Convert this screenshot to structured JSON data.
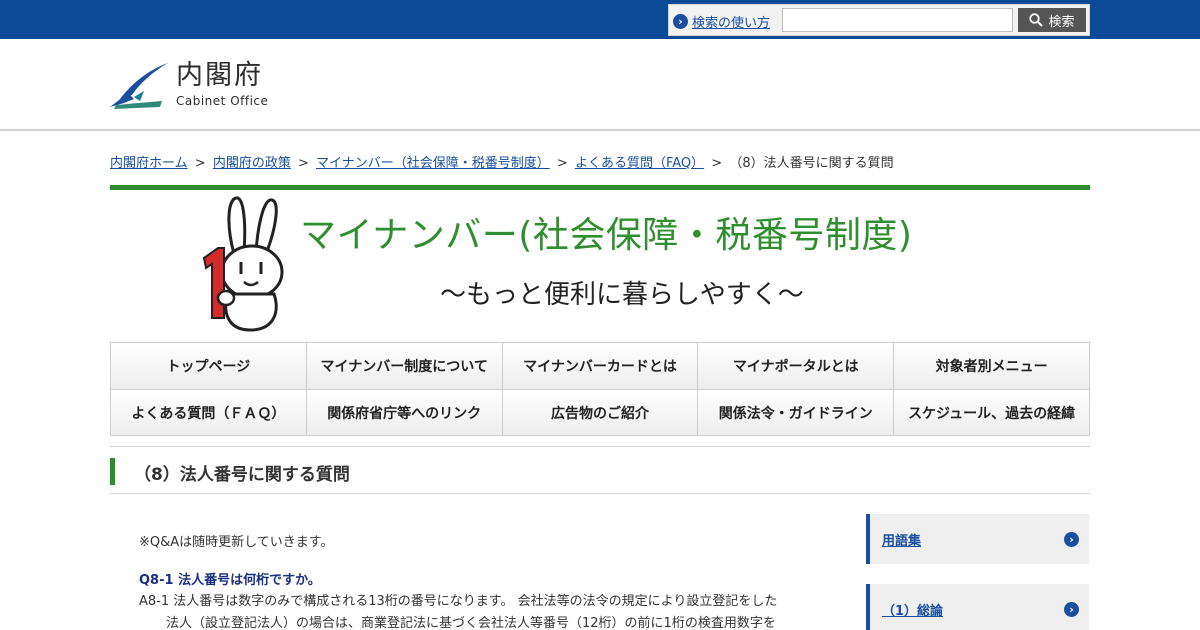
{
  "topbar": {
    "search_help_label": "検索の使い方",
    "search_placeholder": "",
    "search_button_label": "検索",
    "background_color": "#0a4a96"
  },
  "header": {
    "logo_ja": "内閣府",
    "logo_en": "Cabinet Office"
  },
  "breadcrumb": {
    "items": [
      "内閣府ホーム",
      "内閣府の政策",
      "マイナンバー（社会保障・税番号制度）",
      "よくある質問（FAQ）"
    ],
    "current": "（8）法人番号に関する質問",
    "separator": ">"
  },
  "banner": {
    "title": "マイナンバー(社会保障・税番号制度)",
    "subtitle": "〜もっと便利に暮らしやすく〜",
    "accent_color": "#2e8b2e"
  },
  "nav": {
    "row1": [
      "トップページ",
      "マイナンバー制度について",
      "マイナンバーカードとは",
      "マイナポータルとは",
      "対象者別メニュー"
    ],
    "row2": [
      "よくある質問（ＦＡＱ）",
      "関係府省庁等へのリンク",
      "広告物のご紹介",
      "関係法令・ガイドライン",
      "スケジュール、過去の経緯"
    ]
  },
  "section": {
    "heading": "（8）法人番号に関する質問"
  },
  "content": {
    "notice": "※Q&Aは随時更新していきます。",
    "question": "Q8-1  法人番号は何桁ですか。",
    "answer_line1": "A8-1  法人番号は数字のみで構成される13桁の番号になります。 会社法等の法令の規定により設立登記をした",
    "answer_line2": "法人（設立登記法人）の場合は、商業登記法に基づく会社法人等番号（12桁）の前に1桁の検査用数字を"
  },
  "sidebar": {
    "items": [
      "用語集",
      "（1）総論"
    ]
  }
}
